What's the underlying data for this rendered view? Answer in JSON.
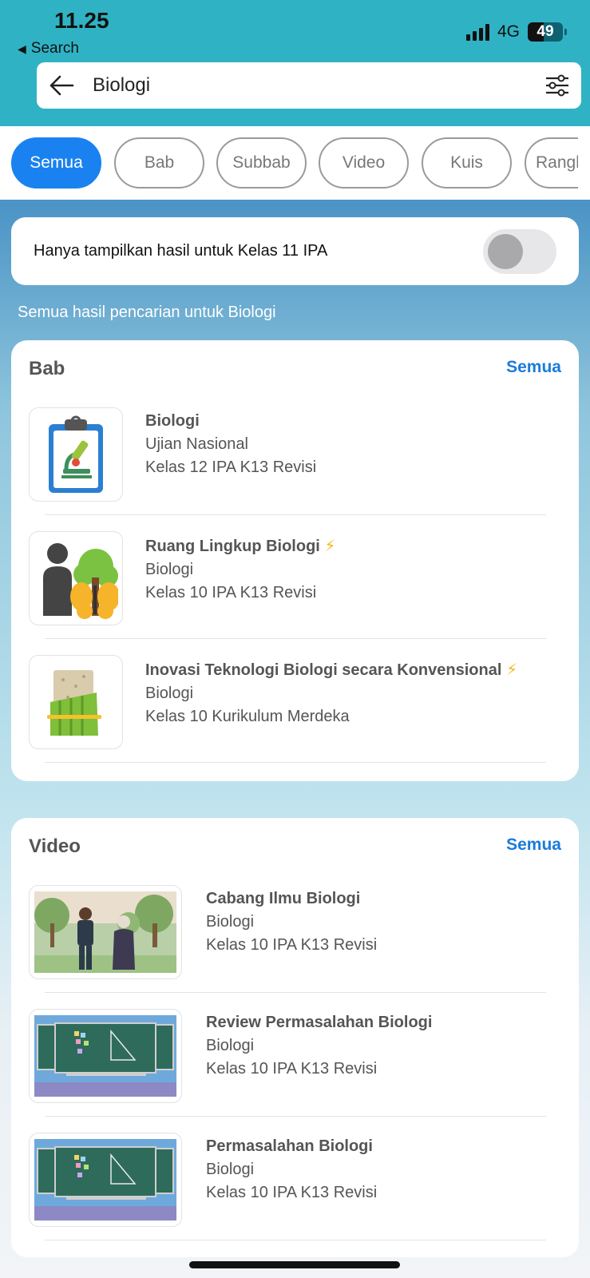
{
  "status": {
    "time": "11.25",
    "back_app": "Search",
    "network": "4G",
    "battery": "49"
  },
  "search": {
    "query": "Biologi"
  },
  "tabs": [
    {
      "label": "Semua",
      "active": true
    },
    {
      "label": "Bab",
      "active": false
    },
    {
      "label": "Subbab",
      "active": false
    },
    {
      "label": "Video",
      "active": false
    },
    {
      "label": "Kuis",
      "active": false
    },
    {
      "label": "Rangk",
      "active": false
    }
  ],
  "filter_toggle": {
    "label": "Hanya tampilkan hasil untuk  Kelas 11 IPA",
    "on": false
  },
  "results_caption": "Semua hasil pencarian untuk Biologi",
  "bab": {
    "title": "Bab",
    "see_all": "Semua",
    "items": [
      {
        "title": "Biologi",
        "subtitle": "Ujian Nasional",
        "grade": "Kelas 12 IPA K13 Revisi",
        "bolt": false,
        "icon": "microscope-clipboard-icon"
      },
      {
        "title": "Ruang Lingkup Biologi",
        "subtitle": "Biologi",
        "grade": "Kelas 10 IPA K13 Revisi",
        "bolt": true,
        "icon": "human-tree-butterfly-icon"
      },
      {
        "title": "Inovasi Teknologi Biologi secara Konvensional",
        "subtitle": "Biologi",
        "grade": "Kelas 10 Kurikulum Merdeka",
        "bolt": true,
        "icon": "tempeh-icon"
      }
    ]
  },
  "video": {
    "title": "Video",
    "see_all": "Semua",
    "items": [
      {
        "title": "Cabang Ilmu Biologi",
        "subtitle": "Biologi",
        "grade": "Kelas 10 IPA K13 Revisi"
      },
      {
        "title": "Review Permasalahan Biologi",
        "subtitle": "Biologi",
        "grade": "Kelas 10 IPA K13 Revisi"
      },
      {
        "title": "Permasalahan Biologi",
        "subtitle": "Biologi",
        "grade": "Kelas 10 IPA K13 Revisi"
      }
    ]
  },
  "bolt_glyph": "⚡",
  "colors": {
    "header": "#2fb3c4",
    "accent": "#1a82f0",
    "link": "#1a7bdc",
    "bolt": "#f3b81c"
  }
}
